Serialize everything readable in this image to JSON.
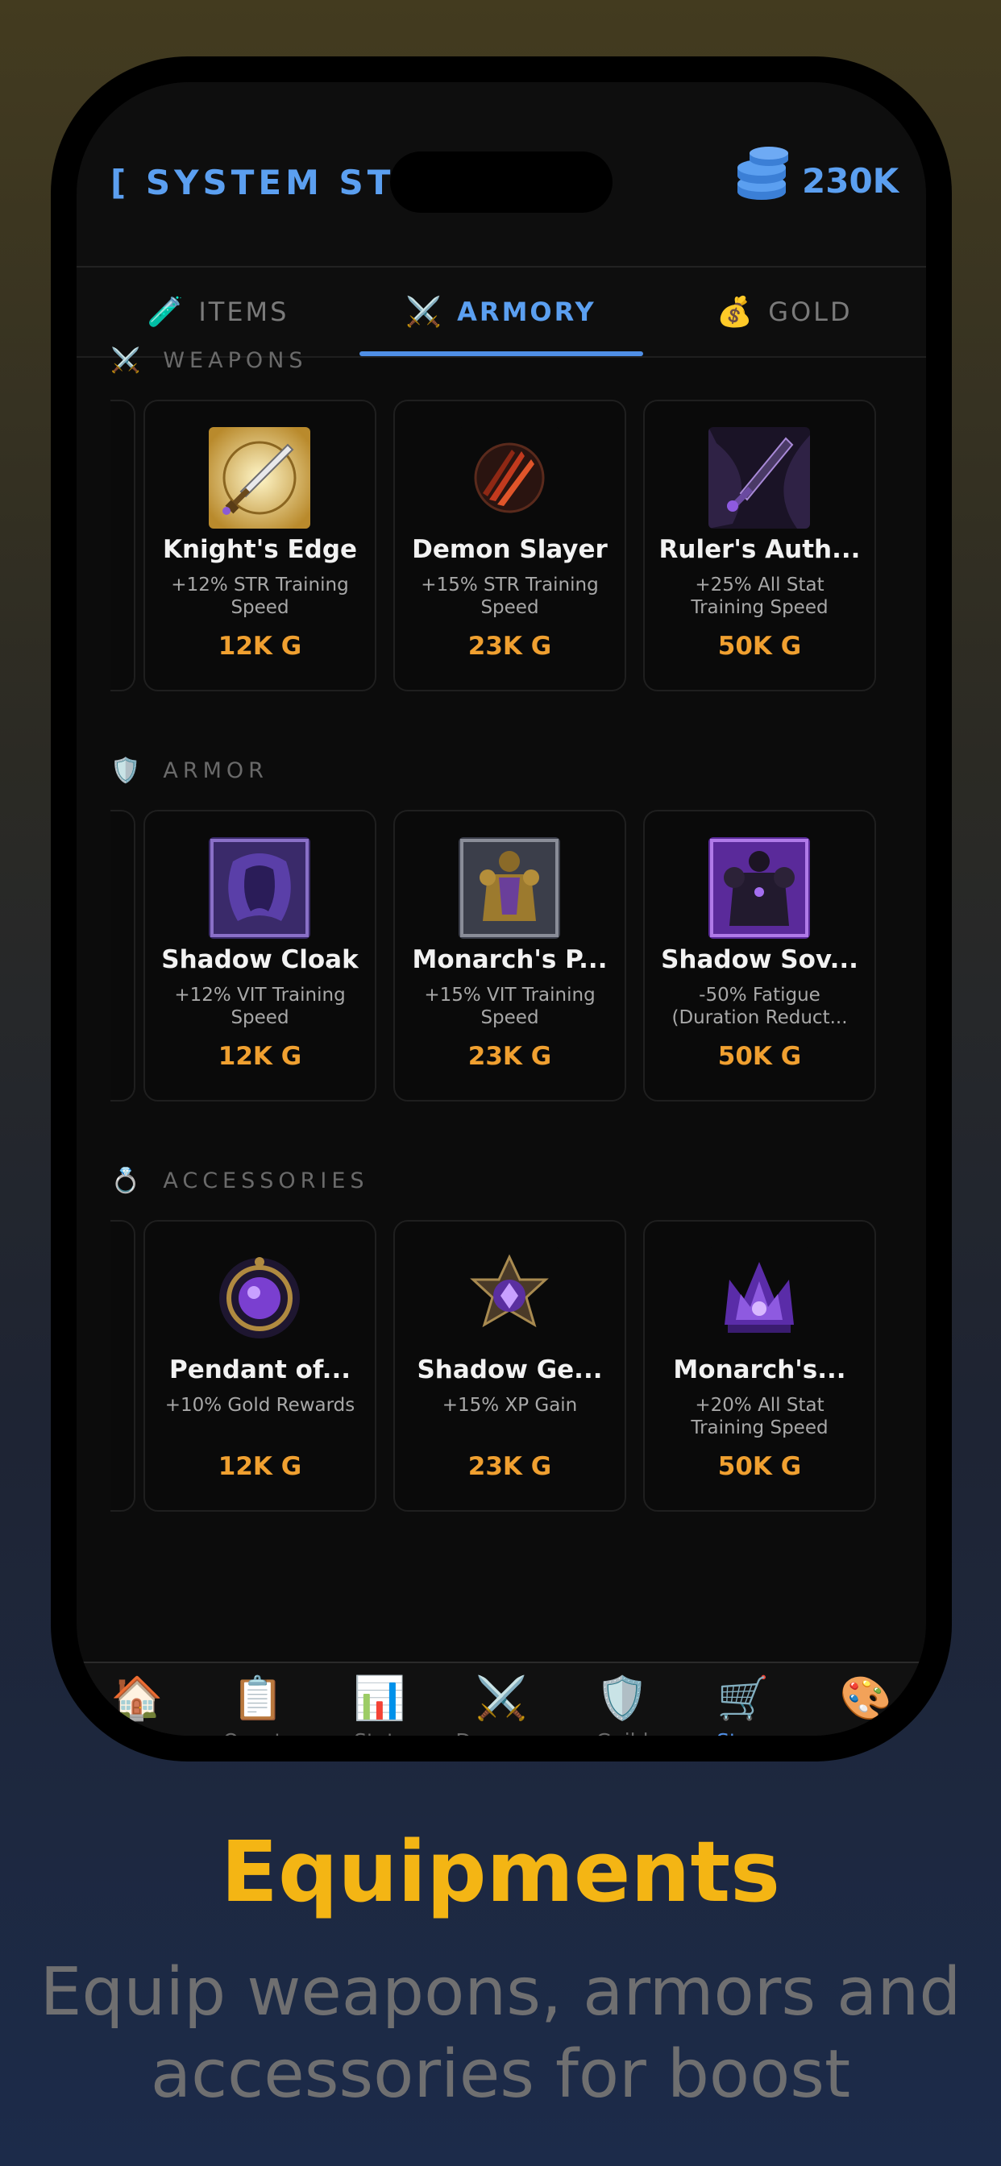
{
  "header": {
    "title": "[ SYSTEM STORE ]",
    "coins": "230K",
    "coins_icon": "coin-stack-icon"
  },
  "tabs": [
    {
      "label": "ITEMS",
      "icon": "🧪",
      "active": false
    },
    {
      "label": "ARMORY",
      "icon": "⚔️",
      "active": true
    },
    {
      "label": "GOLD",
      "icon": "💰",
      "active": false
    }
  ],
  "sections": {
    "weapons": {
      "title": "WEAPONS",
      "icon": "⚔️",
      "items": [
        {
          "name": "Knight's Edge",
          "desc": "+12% STR Training Speed",
          "price": "12K G"
        },
        {
          "name": "Demon Slayer",
          "desc": "+15% STR Training Speed",
          "price": "23K G"
        },
        {
          "name": "Ruler's Auth...",
          "desc": "+25% All Stat Training Speed",
          "price": "50K G"
        }
      ]
    },
    "armor": {
      "title": "ARMOR",
      "icon": "🛡️",
      "items": [
        {
          "name": "Shadow Cloak",
          "desc": "+12% VIT Training Speed",
          "price": "12K G"
        },
        {
          "name": "Monarch's P...",
          "desc": "+15% VIT Training Speed",
          "price": "23K G"
        },
        {
          "name": "Shadow Sov...",
          "desc": "-50% Fatigue (Duration Reduct...",
          "price": "50K G"
        }
      ]
    },
    "accessories": {
      "title": "ACCESSORIES",
      "icon": "💍",
      "items": [
        {
          "name": "Pendant of...",
          "desc": "+10% Gold Rewards",
          "price": "12K G"
        },
        {
          "name": "Shadow Ge...",
          "desc": "+15% XP Gain",
          "price": "23K G"
        },
        {
          "name": "Monarch's...",
          "desc": "+20% All Stat Training Speed",
          "price": "50K G"
        }
      ]
    }
  },
  "nav": [
    {
      "label": "Home",
      "icon": "🏠"
    },
    {
      "label": "Quests",
      "icon": "📋"
    },
    {
      "label": "Stats",
      "icon": "📊"
    },
    {
      "label": "Dungeon",
      "icon": "⚔️"
    },
    {
      "label": "Guild",
      "icon": "🛡️"
    },
    {
      "label": "Store",
      "icon": "🛒",
      "active": true
    },
    {
      "label": "Style",
      "icon": "🎨"
    }
  ],
  "marketing": {
    "headline": "Equipments",
    "subline": "Equip weapons, armors and accessories for boost"
  }
}
